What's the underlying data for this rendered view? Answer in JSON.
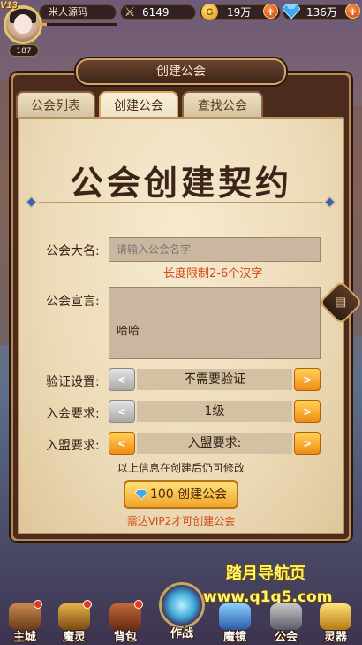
{
  "topbar": {
    "vip": "V13",
    "level": "187",
    "player_name": "米人源码",
    "power": "6149",
    "gold": "19万",
    "gems": "136万"
  },
  "panel": {
    "title": "创建公会",
    "tabs": [
      "公会列表",
      "创建公会",
      "查找公会"
    ],
    "big_title": "公会创建契约",
    "name_label": "公会大名:",
    "name_placeholder": "请输入公会名字",
    "name_hint": "长度限制2-6个汉字",
    "decl_label": "公会宣言:",
    "decl_value": "哈哈",
    "verify_label": "验证设置:",
    "verify_value": "不需要验证",
    "join_label": "入会要求:",
    "join_value": "1级",
    "alliance_label": "入盟要求:",
    "alliance_value": "入盟要求:",
    "info_note": "以上信息在创建后仍可修改",
    "create_label": "100 创建公会",
    "vip_note": "需达VIP2才可创建公会",
    "arrow_left": "<",
    "arrow_right": ">"
  },
  "watermark": {
    "line1": "踏月导航页",
    "line2": "www.q1q5.com"
  },
  "bottom_nav": [
    "主城",
    "魔灵",
    "背包",
    "作战",
    "魔镜",
    "公会",
    "灵器"
  ],
  "colors": {
    "accent": "#f0a52a",
    "hint": "#d04a15",
    "gem": "#3fa6f0"
  }
}
